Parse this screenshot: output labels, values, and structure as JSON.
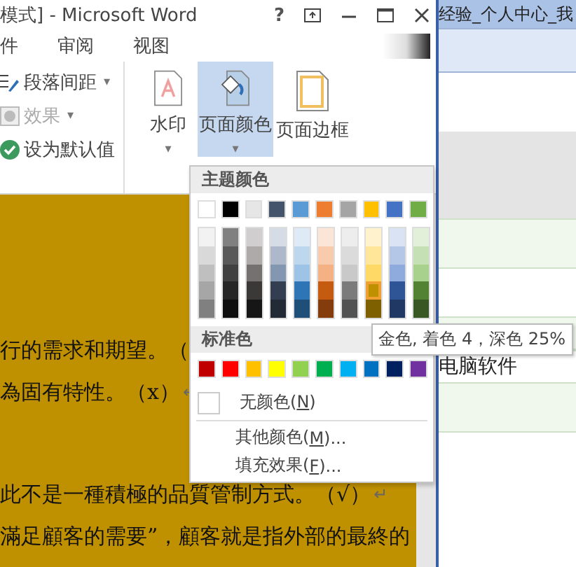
{
  "window": {
    "title": "模式] - Microsoft Word",
    "controls": [
      "?"
    ]
  },
  "tabs": [
    {
      "label": "件",
      "selected": false
    },
    {
      "label": "审阅",
      "selected": false
    },
    {
      "label": "视图",
      "selected": false
    }
  ],
  "ribbon": {
    "format_items": [
      {
        "label": "段落间距",
        "arrow": "▾",
        "disabled": false,
        "kind": "spacing"
      },
      {
        "label": "效果",
        "arrow": "▾",
        "disabled": true,
        "kind": "effects"
      },
      {
        "label": "设为默认值",
        "disabled": false,
        "kind": "default"
      }
    ],
    "buttons": [
      {
        "label": "水印",
        "kind": "watermark",
        "selected": false,
        "arrow": "▾"
      },
      {
        "label": "页面颜色",
        "kind": "page-color",
        "selected": true,
        "arrow": "▾"
      },
      {
        "label": "页面边框",
        "kind": "page-border",
        "selected": false
      }
    ]
  },
  "document": {
    "lines": [
      {
        "text": "行的需求和期望。（"
      },
      {
        "text": "為固有特性。（x）",
        "mark": "↵"
      },
      {
        "text": "此不是一種積極的品質管制方式。（√）",
        "mark": "↵"
      },
      {
        "text": "滿足顧客的需要”，顧客就是指外部的最終的"
      }
    ]
  },
  "color_menu": {
    "theme_header": "主题颜色",
    "theme_colors": [
      {
        "color": "#ffffff",
        "shades": [
          {
            "color": "#f2f2f2",
            "selected": false
          },
          {
            "color": "#d9d9d9",
            "selected": false
          },
          {
            "color": "#bfbfbf",
            "selected": false
          },
          {
            "color": "#a6a6a6",
            "selected": false
          },
          {
            "color": "#808080",
            "selected": false
          }
        ]
      },
      {
        "color": "#000000",
        "shades": [
          {
            "color": "#808080",
            "selected": false
          },
          {
            "color": "#595959",
            "selected": false
          },
          {
            "color": "#404040",
            "selected": false
          },
          {
            "color": "#262626",
            "selected": false
          },
          {
            "color": "#0d0d0d",
            "selected": false
          }
        ]
      },
      {
        "color": "#e7e6e6",
        "shades": [
          {
            "color": "#d0cece",
            "selected": false
          },
          {
            "color": "#aeaaaa",
            "selected": false
          },
          {
            "color": "#757171",
            "selected": false
          },
          {
            "color": "#3b3838",
            "selected": false
          },
          {
            "color": "#171616",
            "selected": false
          }
        ]
      },
      {
        "color": "#44546a",
        "shades": [
          {
            "color": "#d6dce5",
            "selected": false
          },
          {
            "color": "#adb9ca",
            "selected": false
          },
          {
            "color": "#8497b0",
            "selected": false
          },
          {
            "color": "#333f50",
            "selected": false
          },
          {
            "color": "#222a35",
            "selected": false
          }
        ]
      },
      {
        "color": "#5b9bd5",
        "shades": [
          {
            "color": "#deebf7",
            "selected": false
          },
          {
            "color": "#bdd7ee",
            "selected": false
          },
          {
            "color": "#9dc3e6",
            "selected": false
          },
          {
            "color": "#2e75b6",
            "selected": false
          },
          {
            "color": "#1f4e79",
            "selected": false
          }
        ]
      },
      {
        "color": "#ed7d31",
        "shades": [
          {
            "color": "#fbe5d6",
            "selected": false
          },
          {
            "color": "#f8cbad",
            "selected": false
          },
          {
            "color": "#f4b183",
            "selected": false
          },
          {
            "color": "#c55a11",
            "selected": false
          },
          {
            "color": "#843c0c",
            "selected": false
          }
        ]
      },
      {
        "color": "#a5a5a5",
        "shades": [
          {
            "color": "#ededed",
            "selected": false
          },
          {
            "color": "#dbdbdb",
            "selected": false
          },
          {
            "color": "#c9c9c9",
            "selected": false
          },
          {
            "color": "#7b7b7b",
            "selected": false
          },
          {
            "color": "#525252",
            "selected": false
          }
        ]
      },
      {
        "color": "#ffc000",
        "shades": [
          {
            "color": "#fff2cc",
            "selected": false
          },
          {
            "color": "#ffe699",
            "selected": false
          },
          {
            "color": "#ffd966",
            "selected": false
          },
          {
            "color": "#bf9000",
            "selected": true
          },
          {
            "color": "#7f6000",
            "selected": false
          }
        ]
      },
      {
        "color": "#4472c4",
        "shades": [
          {
            "color": "#dae3f3",
            "selected": false
          },
          {
            "color": "#b4c7e7",
            "selected": false
          },
          {
            "color": "#8faadc",
            "selected": false
          },
          {
            "color": "#2f5597",
            "selected": false
          },
          {
            "color": "#203864",
            "selected": false
          }
        ]
      },
      {
        "color": "#70ad47",
        "shades": [
          {
            "color": "#e2f0d9",
            "selected": false
          },
          {
            "color": "#c5e0b4",
            "selected": false
          },
          {
            "color": "#a9d18e",
            "selected": false
          },
          {
            "color": "#548235",
            "selected": false
          },
          {
            "color": "#385723",
            "selected": false
          }
        ]
      }
    ],
    "standard_header": "标准色",
    "standard_colors": [
      {
        "color": "#c00000"
      },
      {
        "color": "#ff0000"
      },
      {
        "color": "#ffc000"
      },
      {
        "color": "#ffff00"
      },
      {
        "color": "#92d050"
      },
      {
        "color": "#00b050"
      },
      {
        "color": "#00b0f0"
      },
      {
        "color": "#0070c0"
      },
      {
        "color": "#002060"
      },
      {
        "color": "#7030a0"
      }
    ],
    "no_color": "无颜色(N)",
    "items": [
      "其他颜色(M)...",
      "填充效果(F)..."
    ],
    "tooltip": "金色, 着色 4，深色 25%"
  },
  "browser": {
    "title": "经验_个人中心_我",
    "rows": [
      "电脑软件"
    ]
  }
}
